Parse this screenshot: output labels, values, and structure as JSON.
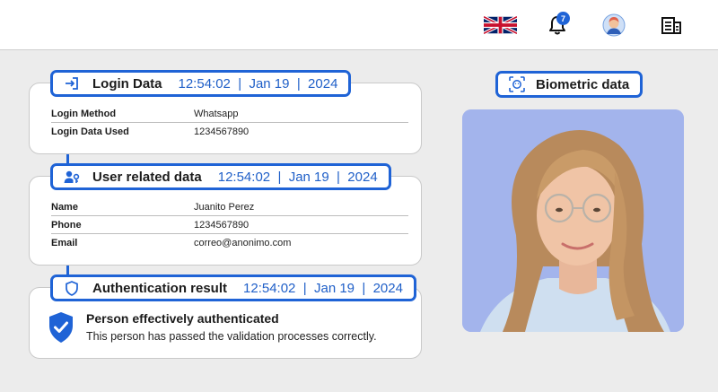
{
  "header": {
    "language_icon": "uk-flag-icon",
    "notifications_icon": "bell-icon",
    "notifications_count": "7",
    "profile_icon": "user-avatar-icon",
    "documents_icon": "building-document-icon"
  },
  "login": {
    "title": "Login Data",
    "meta": "12:54:02  |  Jan 19  |  2024",
    "rows": [
      {
        "label": "Login Method",
        "value": "Whatsapp"
      },
      {
        "label": "Login Data Used",
        "value": "1234567890"
      }
    ]
  },
  "user": {
    "title": "User related data",
    "meta": "12:54:02  |  Jan 19  |  2024",
    "rows": [
      {
        "label": "Name",
        "value": "Juanito Perez"
      },
      {
        "label": "Phone",
        "value": "1234567890"
      },
      {
        "label": "Email",
        "value": "correo@anonimo.com"
      }
    ]
  },
  "auth": {
    "title": "Authentication result",
    "meta": "12:54:02  |  Jan 19  |  2024",
    "status_title": "Person effectively authenticated",
    "status_text": "This person has passed the validation processes correctly."
  },
  "biometric": {
    "title": "Biometric data",
    "photo_background": "#a3b4ec"
  },
  "colors": {
    "accent": "#1f63d6",
    "page_background": "#ececec"
  }
}
